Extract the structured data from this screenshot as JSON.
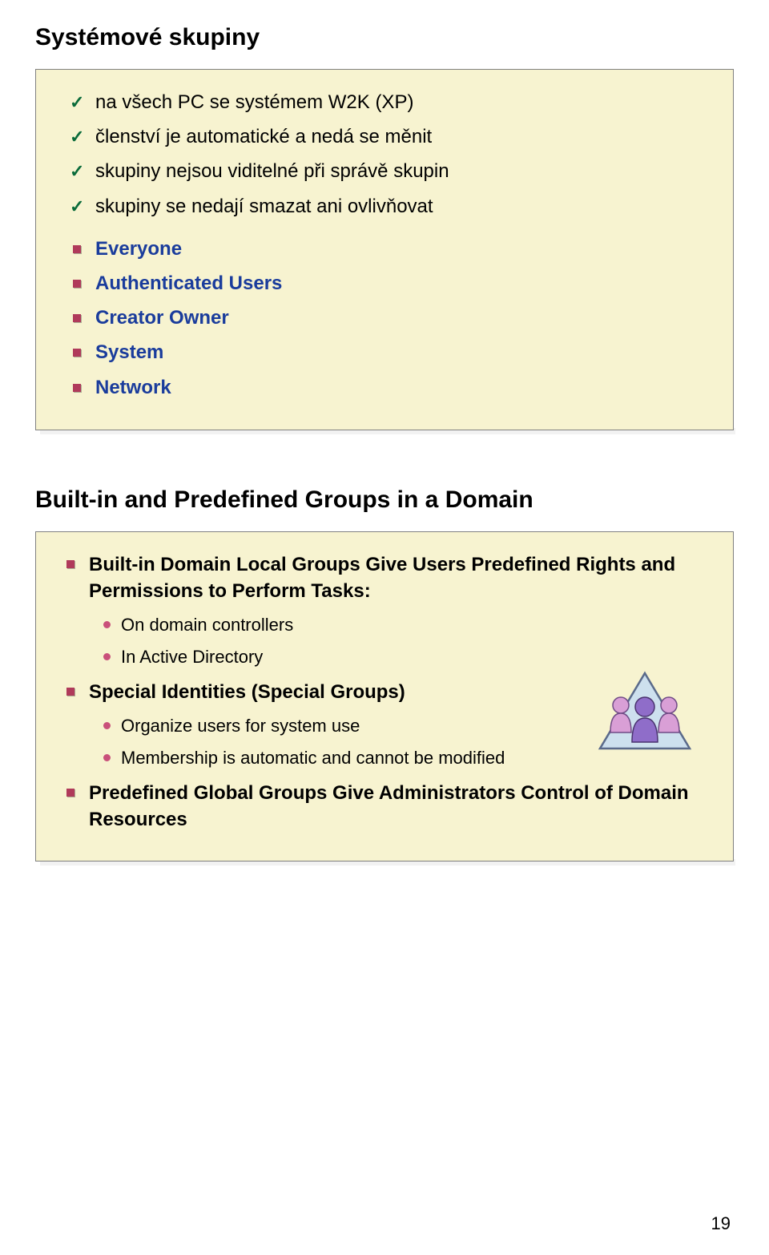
{
  "slide1": {
    "title": "Systémové skupiny",
    "checks": [
      "na všech PC se systémem W2K (XP)",
      "členství je automatické a nedá se měnit",
      "skupiny nejsou viditelné při správě skupin",
      "skupiny se nedají smazat ani ovlivňovat"
    ],
    "squares": [
      "Everyone",
      "Authenticated Users",
      "Creator Owner",
      "System",
      "Network"
    ]
  },
  "slide2": {
    "title": "Built-in and Predefined Groups in a Domain",
    "items": [
      {
        "label": "Built-in Domain Local Groups Give Users Predefined Rights and Permissions to Perform Tasks:",
        "sub": [
          "On domain controllers",
          "In Active Directory"
        ]
      },
      {
        "label": "Special Identities (Special Groups)",
        "sub": [
          "Organize users for system use",
          "Membership is automatic and cannot be modified"
        ]
      },
      {
        "label": "Predefined Global Groups Give Administrators Control of Domain Resources",
        "sub": []
      }
    ]
  },
  "page_number": "19"
}
